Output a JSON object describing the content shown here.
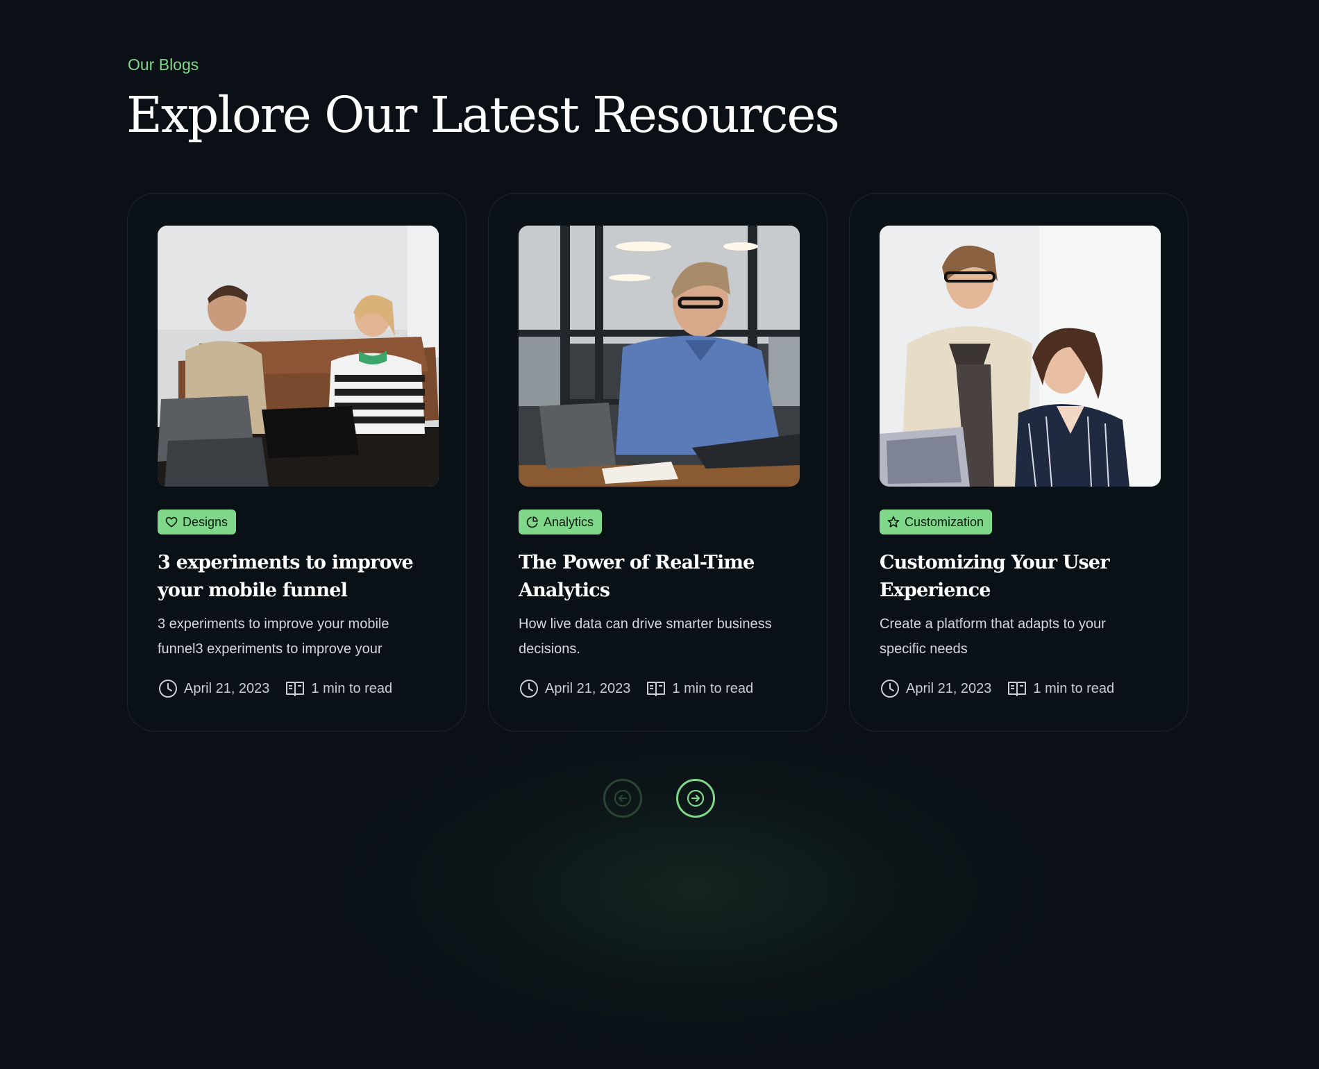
{
  "section": {
    "eyebrow": "Our Blogs",
    "title": "Explore Our Latest Resources"
  },
  "colors": {
    "accent": "#7fd88a",
    "background": "#0a1016",
    "card_border": "#1d252c"
  },
  "cards": [
    {
      "image_icon": "photo-two-colleagues-with-laptop-and-notebook",
      "tag": {
        "label": "Designs",
        "icon": "heart-icon"
      },
      "title": "3 experiments to improve your mobile funnel",
      "description": "3 experiments to improve your mobile funnel3 experiments to improve your",
      "date": "April 21, 2023",
      "read_time": "1 min to read"
    },
    {
      "image_icon": "photo-man-with-glasses-typing-on-laptop",
      "tag": {
        "label": "Analytics",
        "icon": "pie-chart-icon"
      },
      "title": "The Power of Real-Time Analytics",
      "description": "How live data can drive smarter business decisions.",
      "date": "April 21, 2023",
      "read_time": "1 min to read"
    },
    {
      "image_icon": "photo-two-women-looking-at-laptop",
      "tag": {
        "label": "Customization",
        "icon": "star-icon"
      },
      "title": "Customizing Your User Experience",
      "description": "Create a platform that adapts to your specific needs",
      "date": "April 21, 2023",
      "read_time": "1 min to read"
    }
  ],
  "navigation": {
    "prev_icon": "arrow-left-icon",
    "next_icon": "arrow-right-icon",
    "prev_enabled": false,
    "next_enabled": true
  }
}
